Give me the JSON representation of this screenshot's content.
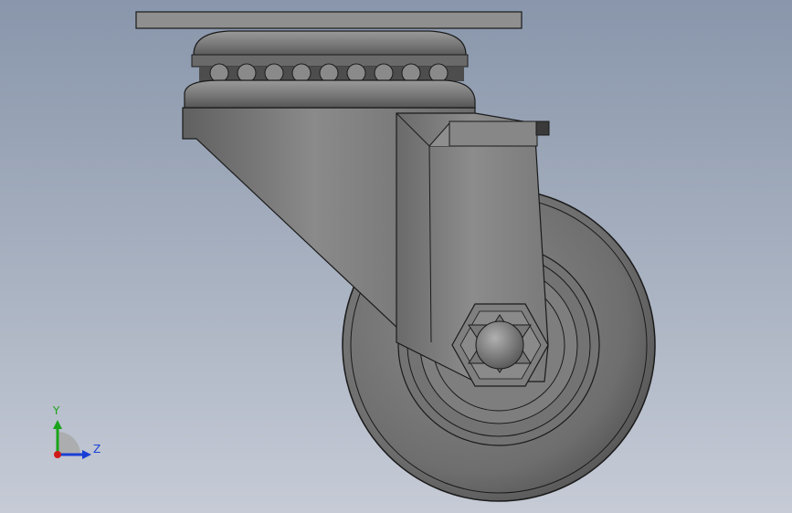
{
  "view": {
    "background_top": "#8996ab",
    "background_bottom": "#c6cbd6"
  },
  "model": {
    "name": "swivel-caster-wheel",
    "body_color": "#7a7a7a",
    "edge_color": "#1a1a1a"
  },
  "triad": {
    "y_label": "Y",
    "z_label": "Z",
    "y_color": "#1aa31a",
    "z_color": "#1a3fd6",
    "x_color": "#d01a1a"
  }
}
